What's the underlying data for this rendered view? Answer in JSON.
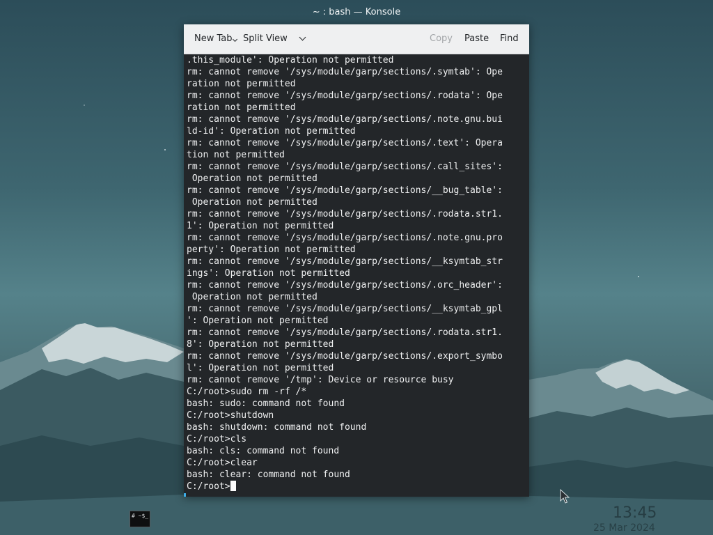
{
  "window": {
    "title": "~ : bash — Konsole"
  },
  "toolbar": {
    "new_tab": "New Tab",
    "split_view": "Split View",
    "copy": "Copy",
    "paste": "Paste",
    "find": "Find"
  },
  "terminal": {
    "lines": [
      ".this_module': Operation not permitted",
      "rm: cannot remove '/sys/module/garp/sections/.symtab': Ope",
      "ration not permitted",
      "rm: cannot remove '/sys/module/garp/sections/.rodata': Ope",
      "ration not permitted",
      "rm: cannot remove '/sys/module/garp/sections/.note.gnu.bui",
      "ld-id': Operation not permitted",
      "rm: cannot remove '/sys/module/garp/sections/.text': Opera",
      "tion not permitted",
      "rm: cannot remove '/sys/module/garp/sections/.call_sites':",
      " Operation not permitted",
      "rm: cannot remove '/sys/module/garp/sections/__bug_table':",
      " Operation not permitted",
      "rm: cannot remove '/sys/module/garp/sections/.rodata.str1.",
      "1': Operation not permitted",
      "rm: cannot remove '/sys/module/garp/sections/.note.gnu.pro",
      "perty': Operation not permitted",
      "rm: cannot remove '/sys/module/garp/sections/__ksymtab_str",
      "ings': Operation not permitted",
      "rm: cannot remove '/sys/module/garp/sections/.orc_header':",
      " Operation not permitted",
      "rm: cannot remove '/sys/module/garp/sections/__ksymtab_gpl",
      "': Operation not permitted",
      "rm: cannot remove '/sys/module/garp/sections/.rodata.str1.",
      "8': Operation not permitted",
      "rm: cannot remove '/sys/module/garp/sections/.export_symbo",
      "l': Operation not permitted",
      "rm: cannot remove '/tmp': Device or resource busy",
      "C:/root>sudo rm -rf /*",
      "bash: sudo: command not found",
      "C:/root>shutdown",
      "bash: shutdown: command not found",
      "C:/root>cls",
      "bash: cls: command not found",
      "C:/root>clear",
      "bash: clear: command not found"
    ],
    "prompt": "C:/root>"
  },
  "taskbar": {
    "task_thumbnail_text": "# ~$_"
  },
  "clock": {
    "time": "13:45",
    "date": "25 Mar 2024"
  },
  "colors": {
    "terminal_bg": "#232629",
    "terminal_fg": "#eff0f1",
    "toolbar_bg": "#eff0f1",
    "accent": "#3daee9"
  },
  "icons": {
    "split_view_dropdown": "chevron-down-icon",
    "new_tab_dropdown": "chevron-down-icon",
    "pointer": "mouse-pointer-icon"
  }
}
